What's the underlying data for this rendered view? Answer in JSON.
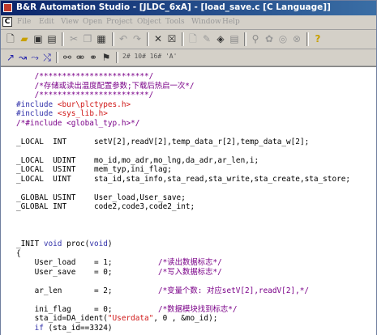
{
  "window": {
    "title": "B&R Automation Studio - [JLDC_6xA] - [load_save.c [C Language]]"
  },
  "menu": {
    "doc_icon": "C",
    "items": [
      "File",
      "Edit",
      "View",
      "Open",
      "Project",
      "Object",
      "Tools",
      "Window",
      "Help"
    ]
  },
  "toolbar": {
    "icons": [
      "new-file-icon",
      "open-folder-icon",
      "save-icon",
      "save-all-icon",
      "cut-icon",
      "copy-icon",
      "paste-icon",
      "undo-icon",
      "redo-icon",
      "delete-icon",
      "properties-icon",
      "insert-object-icon",
      "edit-object-icon",
      "open-object-icon",
      "object-list-icon",
      "search-object-icon",
      "build-icon",
      "rebuild-icon",
      "transfer-icon",
      "help-icon"
    ],
    "row2_icons": [
      "line-tool-icon",
      "curve-tool-icon",
      "polyline-tool-icon",
      "erase-tool-icon",
      "find-icon",
      "find-replace-icon",
      "find-next-icon",
      "bookmark-icon"
    ],
    "row2_text": "2#  10#  16#  'A'"
  },
  "code": {
    "lines": [
      [
        {
          "c": "comment",
          "t": "    /************************/"
        }
      ],
      [
        {
          "c": "comment",
          "t": "    /*存储或读出温度配置参数;下载后热启一次*/"
        }
      ],
      [
        {
          "c": "comment",
          "t": "    /************************/"
        }
      ],
      [
        {
          "c": "kw",
          "t": "#include "
        },
        {
          "c": "str",
          "t": "<bur\\plctypes.h>"
        }
      ],
      [
        {
          "c": "kw",
          "t": "#include "
        },
        {
          "c": "str",
          "t": "<sys_lib.h>"
        }
      ],
      [
        {
          "c": "comment",
          "t": "/*#include <global_typ.h>*/"
        }
      ],
      [
        {
          "c": "text",
          "t": ""
        }
      ],
      [
        {
          "c": "text",
          "t": "_LOCAL  INT      setV[2],readV[2],temp_data_r[2],temp_data_w[2];"
        }
      ],
      [
        {
          "c": "text",
          "t": ""
        }
      ],
      [
        {
          "c": "text",
          "t": "_LOCAL  UDINT    mo_id,mo_adr,mo_lng,da_adr,ar_len,i;"
        }
      ],
      [
        {
          "c": "text",
          "t": "_LOCAL  USINT    mem_typ,ini_flag;"
        }
      ],
      [
        {
          "c": "text",
          "t": "_LOCAL  UINT     sta_id,sta_info,sta_read,sta_write,sta_create,sta_store;"
        }
      ],
      [
        {
          "c": "text",
          "t": ""
        }
      ],
      [
        {
          "c": "text",
          "t": "_GLOBAL USINT    User_load,User_save;"
        }
      ],
      [
        {
          "c": "text",
          "t": "_GLOBAL INT      code2,code3,code2_int;"
        }
      ],
      [
        {
          "c": "text",
          "t": ""
        }
      ],
      [
        {
          "c": "text",
          "t": ""
        }
      ],
      [
        {
          "c": "text",
          "t": ""
        }
      ],
      [
        {
          "c": "text",
          "t": "_INIT "
        },
        {
          "c": "kw",
          "t": "void"
        },
        {
          "c": "text",
          "t": " proc("
        },
        {
          "c": "kw",
          "t": "void"
        },
        {
          "c": "text",
          "t": ")"
        }
      ],
      [
        {
          "c": "text",
          "t": "{"
        }
      ],
      [
        {
          "c": "text",
          "t": "    User_load    = 1;          "
        },
        {
          "c": "comment",
          "t": "/*读出数据标志*/"
        }
      ],
      [
        {
          "c": "text",
          "t": "    User_save    = 0;          "
        },
        {
          "c": "comment",
          "t": "/*写入数据标志*/"
        }
      ],
      [
        {
          "c": "text",
          "t": ""
        }
      ],
      [
        {
          "c": "text",
          "t": "    ar_len       = 2;          "
        },
        {
          "c": "comment",
          "t": "/*变量个数: 对应setV[2],readV[2],*/"
        }
      ],
      [
        {
          "c": "text",
          "t": ""
        }
      ],
      [
        {
          "c": "text",
          "t": "    ini_flag     = 0;          "
        },
        {
          "c": "comment",
          "t": "/*数据模块找到标志*/"
        }
      ],
      [
        {
          "c": "text",
          "t": "    sta_id=DA_ident("
        },
        {
          "c": "str",
          "t": "\"Userdata\""
        },
        {
          "c": "text",
          "t": ", 0 , &mo_id);"
        }
      ],
      [
        {
          "c": "text",
          "t": "    "
        },
        {
          "c": "kw",
          "t": "if"
        },
        {
          "c": "text",
          "t": " (sta_id==3324)"
        }
      ]
    ]
  }
}
